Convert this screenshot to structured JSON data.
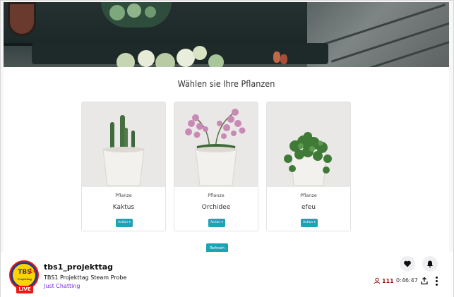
{
  "page": {
    "heading": "Wählen sie Ihre Pflanzen",
    "cards": [
      {
        "category": "Pflanze",
        "name": "Kaktus",
        "action_label": "Action"
      },
      {
        "category": "Pflanze",
        "name": "Orchidee",
        "action_label": "Action"
      },
      {
        "category": "Pflanze",
        "name": "efeu",
        "action_label": "Action"
      }
    ],
    "refresh_label": "Refresh"
  },
  "stream": {
    "channel_name": "tbs1_projekttag",
    "title": "TBS1 Projekttag Steam Probe",
    "category": "Just Chatting",
    "live_badge": "LIVE",
    "avatar_text": "TBS",
    "avatar_plus": "1+",
    "avatar_subtext": "Projekttag",
    "viewer_count": "111",
    "uptime": "0:46:47"
  },
  "icons": {
    "heart": "heart-icon",
    "bell": "bell-icon",
    "viewers": "person-icon",
    "share": "share-icon",
    "more": "vertical-ellipsis-icon"
  },
  "colors": {
    "button_teal": "#1ea2b8",
    "live_red": "#e91916",
    "category_purple": "#772ce8",
    "viewer_red": "#971311"
  }
}
